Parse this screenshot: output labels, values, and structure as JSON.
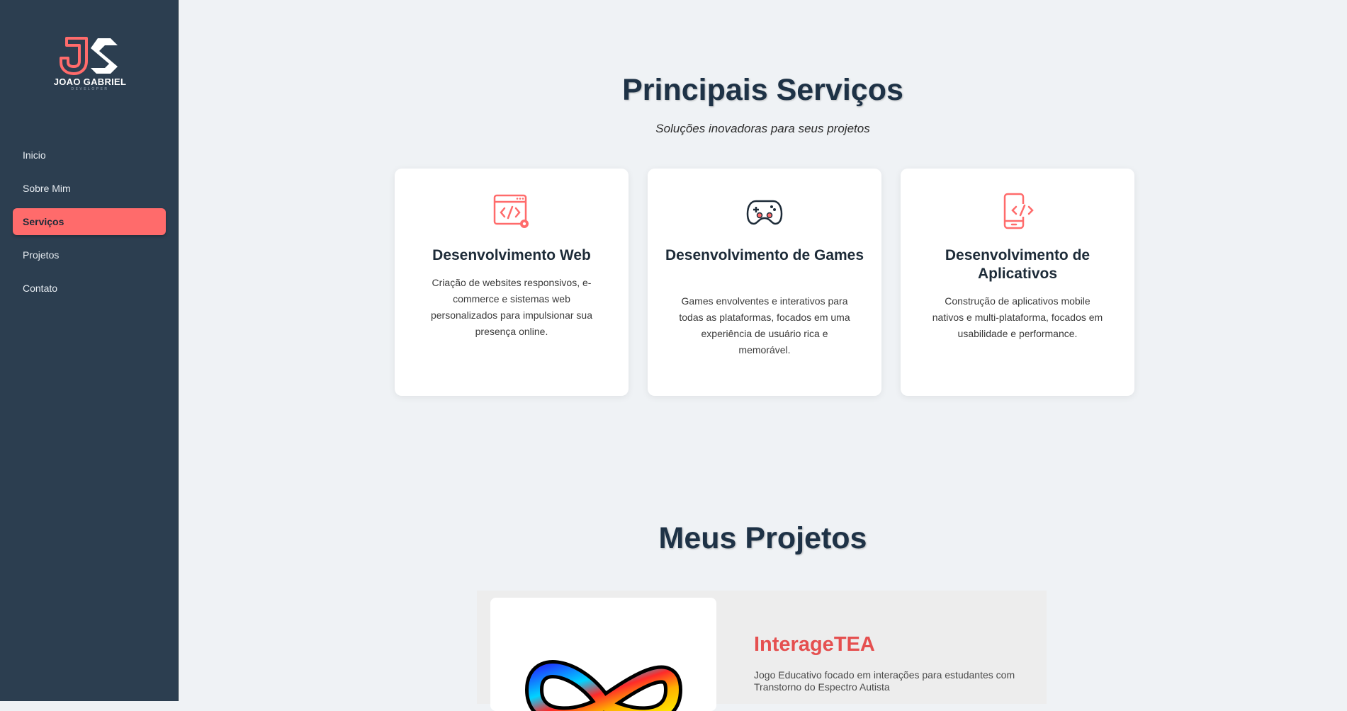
{
  "brand": {
    "name": "JOAO GABRIEL",
    "tagline": "DEVELOPER"
  },
  "nav": {
    "items": [
      {
        "label": "Inicio"
      },
      {
        "label": "Sobre Mim"
      },
      {
        "label": "Serviços",
        "active": true
      },
      {
        "label": "Projetos"
      },
      {
        "label": "Contato"
      }
    ]
  },
  "services": {
    "title": "Principais Serviços",
    "subtitle": "Soluções inovadoras para seus projetos",
    "cards": [
      {
        "icon": "web-code-icon",
        "title": "Desenvolvimento Web",
        "description": "Criação de websites responsivos, e-commerce e sistemas web personalizados para impulsionar sua presença online."
      },
      {
        "icon": "gamepad-icon",
        "title": "Desenvolvimento de Games",
        "description": "Games envolventes e interativos para todas as plataformas, focados em uma experiência de usuário rica e memorável."
      },
      {
        "icon": "mobile-code-icon",
        "title": "Desenvolvimento de Aplicativos",
        "description": "Construção de aplicativos mobile nativos e multi-plataforma, focados em usabilidade e performance."
      }
    ]
  },
  "projects": {
    "title": "Meus Projetos",
    "items": [
      {
        "title": "InterageTEA",
        "description": "Jogo Educativo focado em interações para estudantes com Transtorno do Espectro Autista"
      }
    ]
  },
  "colors": {
    "sidebar": "#2c3e50",
    "accent": "#ff6b6b",
    "background": "#eff2f5",
    "heading": "#1e3246"
  }
}
